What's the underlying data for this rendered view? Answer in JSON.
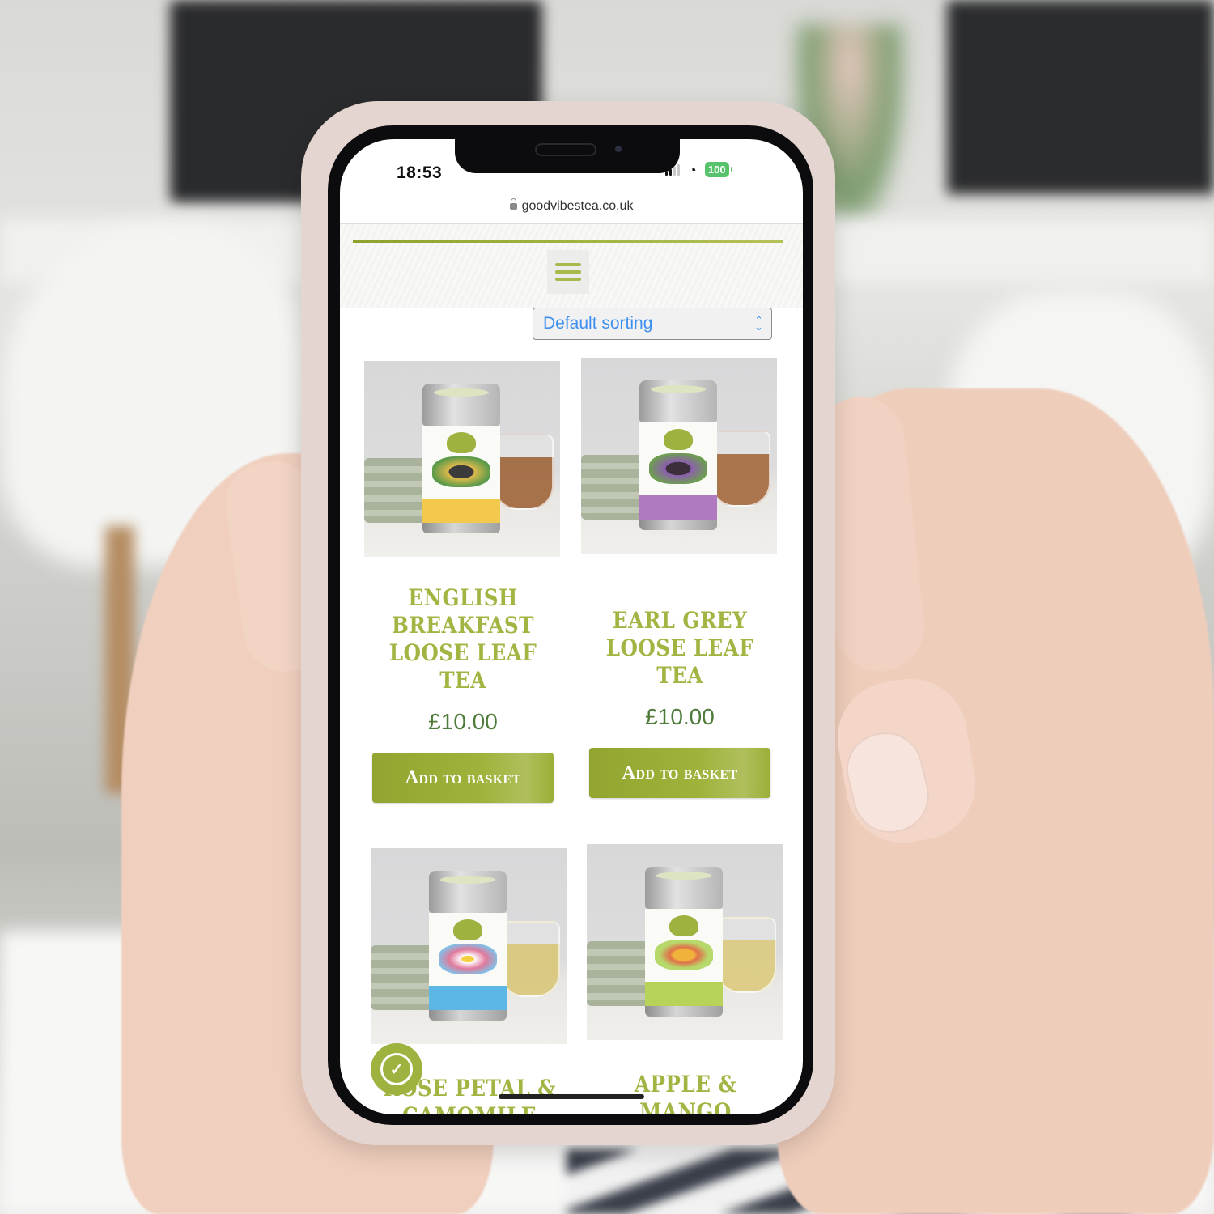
{
  "status_bar": {
    "time": "18:53",
    "battery": "100",
    "signal_icon": "cellular-signal-icon",
    "wifi_icon": "wifi-icon"
  },
  "browser": {
    "url": "goodvibestea.co.uk",
    "lock_icon": "lock-icon"
  },
  "header": {
    "menu_icon": "hamburger-menu-icon",
    "accent_color": "#a4b443"
  },
  "sorting": {
    "selected": "Default sorting"
  },
  "products": [
    {
      "title": "English Breakfast Loose Leaf Tea",
      "price": "£10.00",
      "button": "Add to basket",
      "band_color": "#f2c94c",
      "tea_color": "#a0663a"
    },
    {
      "title": "Earl Grey Loose Leaf Tea",
      "price": "£10.00",
      "button": "Add to basket",
      "band_color": "#b07ac0",
      "tea_color": "#a56a3e"
    },
    {
      "title": "Rose Petal & Camomile",
      "price": "",
      "button": "",
      "band_color": "#5cb7e6",
      "tea_color": "#d9c77a"
    },
    {
      "title": "Apple & Mango Green",
      "price": "",
      "button": "",
      "band_color": "#b8d35a",
      "tea_color": "#dccb80"
    }
  ],
  "cookie_button": {
    "icon": "cookie-consent-icon",
    "glyph": "✓"
  },
  "colors": {
    "brand_green": "#9db23f",
    "price_green": "#4f7b3a",
    "select_blue": "#3f8ff0"
  }
}
